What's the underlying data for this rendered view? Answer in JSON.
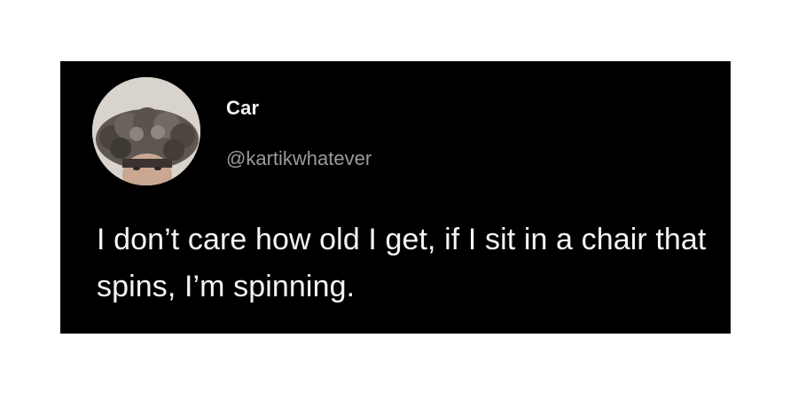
{
  "tweet": {
    "display_name": "Car",
    "handle": "@kartikwhatever",
    "text": "I don’t care how old I get, if I sit in a chair that spins, I’m spinning."
  },
  "colors": {
    "card_background": "#000000",
    "page_background": "#ffffff",
    "name_color": "#f2f2f2",
    "handle_color": "#9a9a9a",
    "text_color": "#f4f4f4"
  }
}
